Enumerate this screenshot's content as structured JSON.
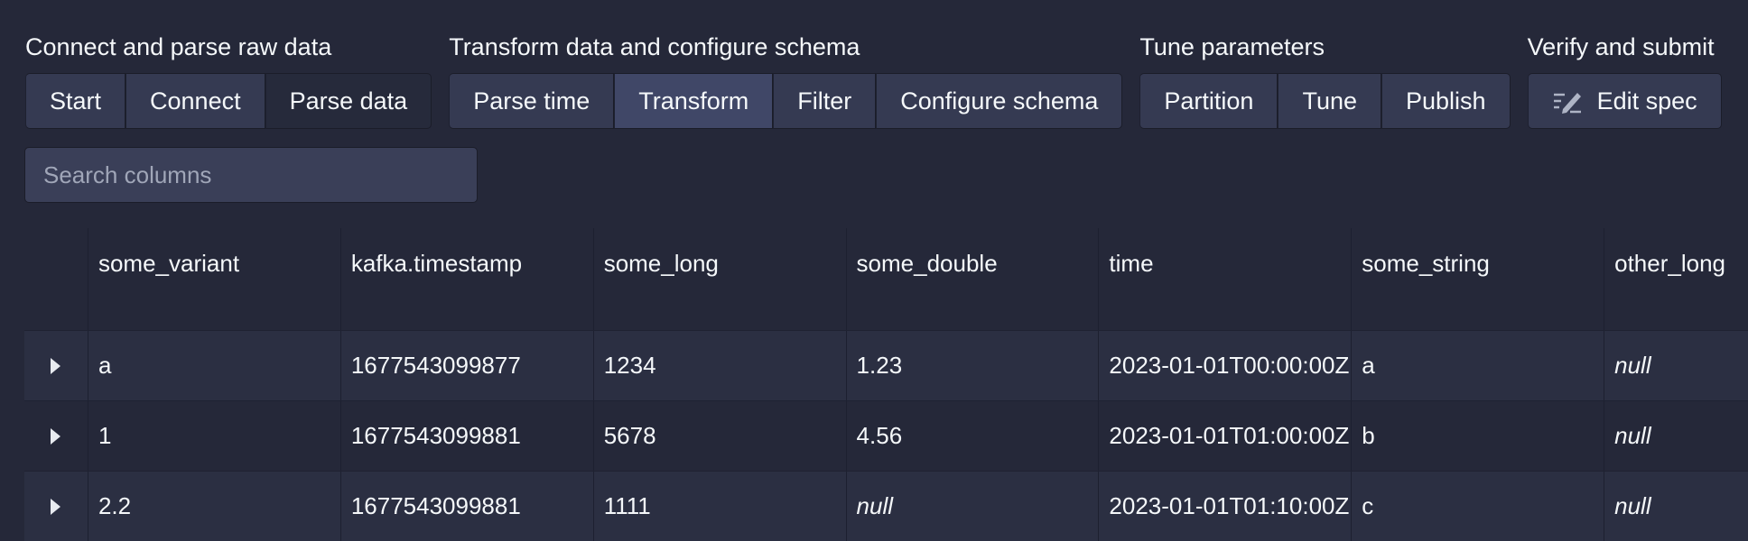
{
  "wizard": {
    "groups": [
      {
        "title": "Connect and parse raw data",
        "buttons": [
          "Start",
          "Connect",
          "Parse data"
        ]
      },
      {
        "title": "Transform data and configure schema",
        "buttons": [
          "Parse time",
          "Transform",
          "Filter",
          "Configure schema"
        ]
      },
      {
        "title": "Tune parameters",
        "buttons": [
          "Partition",
          "Tune",
          "Publish"
        ]
      },
      {
        "title": "Verify and submit",
        "buttons": [
          "Edit spec"
        ]
      }
    ],
    "active_step": "Parse data",
    "edit_spec_icon": "edit-pencil-icon"
  },
  "search": {
    "placeholder": "Search columns",
    "value": ""
  },
  "table": {
    "columns": [
      "some_variant",
      "kafka.timestamp",
      "some_long",
      "some_double",
      "time",
      "some_string",
      "other_long"
    ],
    "rows": [
      [
        "a",
        "1677543099877",
        "1234",
        "1.23",
        "2023-01-01T00:00:00Z",
        "a",
        "null"
      ],
      [
        "1",
        "1677543099881",
        "5678",
        "4.56",
        "2023-01-01T01:00:00Z",
        "b",
        "null"
      ],
      [
        "2.2",
        "1677543099881",
        "1111",
        "null",
        "2023-01-01T01:10:00Z",
        "c",
        "null"
      ]
    ],
    "expand_icon": "caret-right-icon"
  },
  "colors": {
    "background": "#252839",
    "button": "#353a52",
    "button_active": "#262a3b",
    "text": "#f5f8fa"
  }
}
